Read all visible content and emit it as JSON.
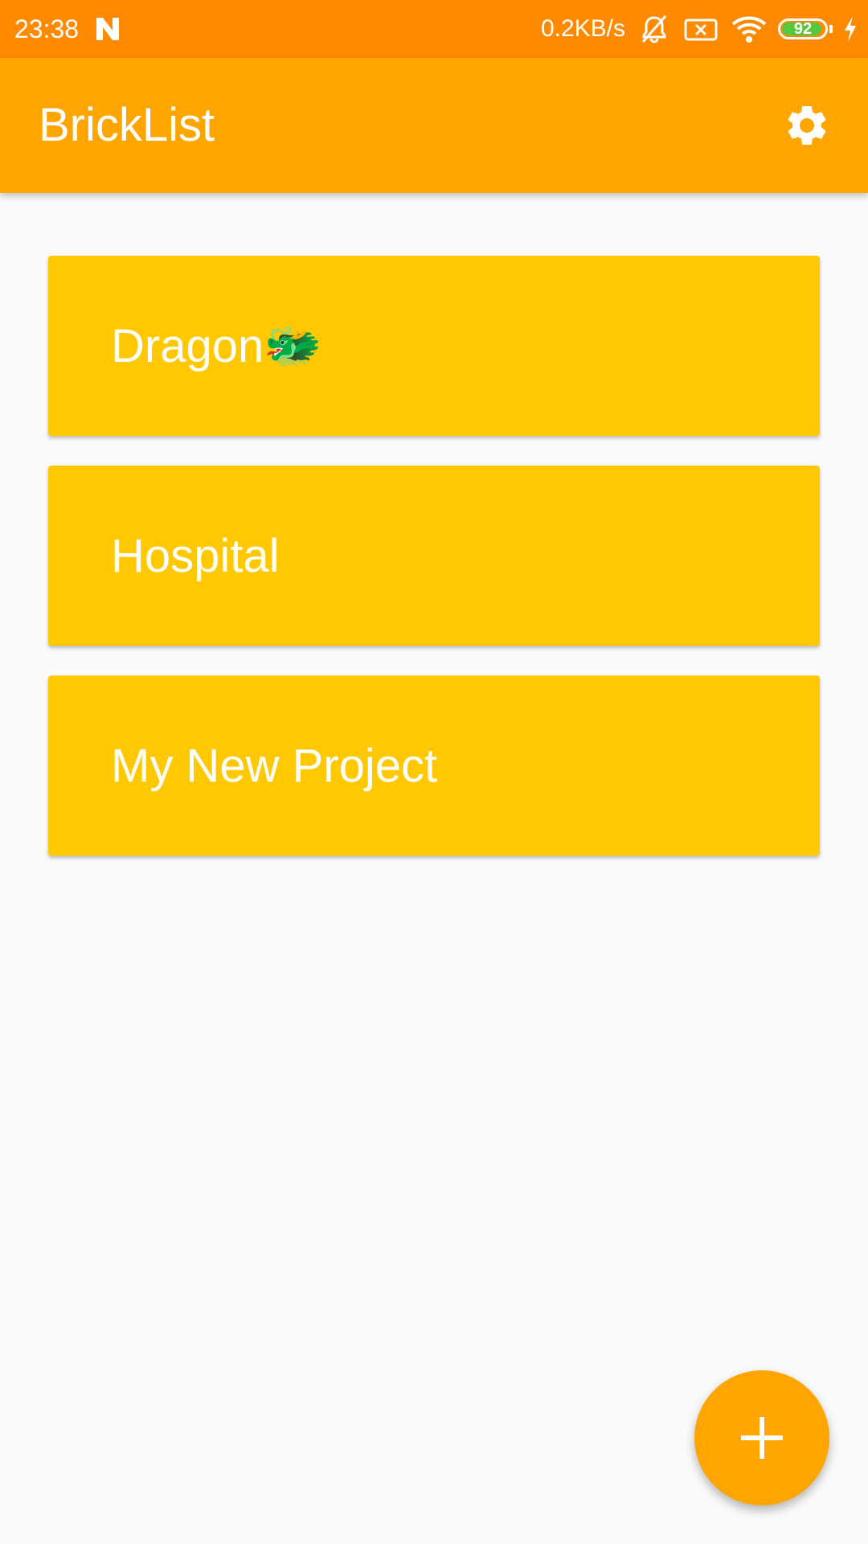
{
  "status_bar": {
    "time": "23:38",
    "net_speed": "0.2KB/s",
    "battery_level": "92",
    "icons": [
      "n-notification-icon",
      "bell-muted-icon",
      "sim-x-icon",
      "wifi-icon",
      "battery-icon",
      "charging-bolt-icon"
    ]
  },
  "app_bar": {
    "title": "BrickList",
    "settings_icon": "gear-icon"
  },
  "projects": [
    {
      "name": "Dragon🐲"
    },
    {
      "name": "Hospital"
    },
    {
      "name": "My New Project"
    }
  ],
  "fab": {
    "icon": "plus-icon"
  },
  "colors": {
    "status_bar": "#ff8a00",
    "primary": "#ffa500",
    "card": "#ffc800",
    "background": "#fafafa",
    "on_primary": "#ffffff"
  }
}
